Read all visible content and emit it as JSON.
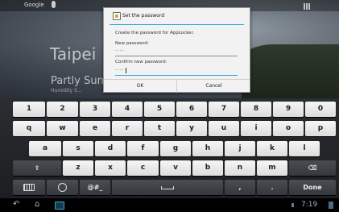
{
  "home": {
    "search_label": "Google",
    "city": "Taipei",
    "weather": "Partly Sunny",
    "weather_detail": "Humidity 5..."
  },
  "dialog": {
    "title": "Set the password",
    "message": "Create the password for AppLocker.",
    "new_password_label": "New password:",
    "new_password_value": "····",
    "confirm_password_label": "Confirm new password:",
    "confirm_password_value": "····",
    "ok_label": "OK",
    "cancel_label": "Cancel",
    "accent_color": "#35a7d8"
  },
  "keyboard": {
    "row1": [
      "1",
      "2",
      "3",
      "4",
      "5",
      "6",
      "7",
      "8",
      "9",
      "0"
    ],
    "row2": [
      "q",
      "w",
      "e",
      "r",
      "t",
      "y",
      "u",
      "i",
      "o",
      "p"
    ],
    "row3": [
      "a",
      "s",
      "d",
      "f",
      "g",
      "h",
      "j",
      "k",
      "l"
    ],
    "row4_letters": [
      "z",
      "x",
      "c",
      "v",
      "b",
      "n",
      "m"
    ],
    "shift_icon": "⇧",
    "backspace_icon": "⌫",
    "symbols_label": "@#_",
    "comma": ",",
    "period": ".",
    "done_label": "Done",
    "space_icon": "␣",
    "keyboard_settings_icon": "keyboard-icon",
    "globe_icon": "globe-icon"
  },
  "navbar": {
    "back_icon": "↶",
    "home_icon": "⌂",
    "clock": "7:19"
  }
}
